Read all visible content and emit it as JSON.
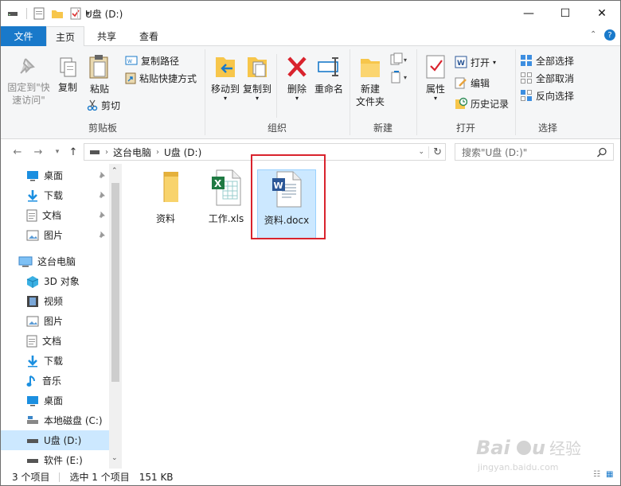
{
  "window": {
    "title": "U盘 (D:)",
    "minimize": "—",
    "maximize": "☐",
    "close": "✕"
  },
  "tabs": {
    "file": "文件",
    "home": "主页",
    "share": "共享",
    "view": "查看"
  },
  "ribbon": {
    "clipboard": {
      "label": "剪贴板",
      "pin_line1": "固定到\"快",
      "pin_line2": "速访问\"",
      "copy": "复制",
      "paste": "粘贴",
      "copy_path": "复制路径",
      "paste_shortcut": "粘贴快捷方式",
      "cut": "剪切"
    },
    "organize": {
      "label": "组织",
      "move_to": "移动到",
      "copy_to": "复制到",
      "delete": "删除",
      "rename": "重命名"
    },
    "new": {
      "label": "新建",
      "new_folder_line1": "新建",
      "new_folder_line2": "文件夹"
    },
    "open": {
      "label": "打开",
      "properties": "属性",
      "open": "打开",
      "edit": "编辑",
      "history": "历史记录"
    },
    "select": {
      "label": "选择",
      "select_all": "全部选择",
      "select_none": "全部取消",
      "invert": "反向选择"
    }
  },
  "address": {
    "path": [
      "这台电脑",
      "U盘 (D:)"
    ],
    "search_placeholder": "搜索\"U盘 (D:)\""
  },
  "nav": {
    "quick_access": [
      {
        "label": "桌面",
        "icon": "desktop-icon"
      },
      {
        "label": "下载",
        "icon": "download-icon"
      },
      {
        "label": "文档",
        "icon": "document-icon"
      },
      {
        "label": "图片",
        "icon": "picture-icon"
      }
    ],
    "this_pc": "这台电脑",
    "pc_items": [
      {
        "label": "3D 对象",
        "icon": "3d-objects-icon"
      },
      {
        "label": "视频",
        "icon": "video-icon"
      },
      {
        "label": "图片",
        "icon": "picture-icon"
      },
      {
        "label": "文档",
        "icon": "document-icon"
      },
      {
        "label": "下载",
        "icon": "download-icon"
      },
      {
        "label": "音乐",
        "icon": "music-icon"
      },
      {
        "label": "桌面",
        "icon": "desktop-icon"
      },
      {
        "label": "本地磁盘 (C:)",
        "icon": "drive-c-icon"
      },
      {
        "label": "U盘 (D:)",
        "icon": "usb-drive-icon"
      },
      {
        "label": "软件 (E:)",
        "icon": "drive-e-icon"
      }
    ]
  },
  "files": [
    {
      "name": "资料",
      "type": "folder"
    },
    {
      "name": "工作.xls",
      "type": "excel"
    },
    {
      "name": "资料.docx",
      "type": "word"
    }
  ],
  "status": {
    "count": "3 个项目",
    "selected": "选中 1 个项目",
    "size": "151 KB"
  },
  "colors": {
    "accent": "#1979ca",
    "selection": "#cce8ff",
    "highlight_box": "#d9232d"
  }
}
